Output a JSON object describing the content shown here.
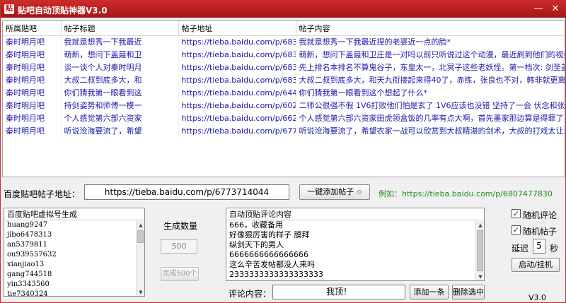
{
  "window": {
    "logo_glyph": "贴",
    "title": "贴吧自动顶贴神器V3.0",
    "minimize": "—",
    "close": "✕"
  },
  "table": {
    "columns": [
      "所属贴吧",
      "帖子标题",
      "帖子地址",
      "帖子内容"
    ],
    "rows": [
      [
        "秦时明月吧",
        "我就是想秀一下我最近",
        "https://tieba.baidu.com/p/683...",
        "我就是想秀一下我最近捏的老婆近一点的脸*"
      ],
      [
        "秦时明月吧",
        "萌新，想问下盖聂和卫",
        "https://tieba.baidu.com/p/683...",
        "萌新，想问下盖聂和卫庄是一对吗以前只听说过这个动漫，最近刷到他们的视频有..."
      ],
      [
        "秦时明月吧",
        "谈一谈个人对秦时明月",
        "https://tieba.baidu.com/p/683...",
        "先上排名本排名不算鬼谷子，东皇太一，北冥子这些老妖怪。第一档次: 剑圣盖聂..."
      ],
      [
        "秦时明月吧",
        "大叔二叔到底多大，和",
        "https://tieba.baidu.com/p/683...",
        "大叔二叔到底多大，和天九衔接起来得40了，赤练，张良也不对，韩非就更离谱，..."
      ],
      [
        "秦时明月吧",
        "你们猜我第一眼看到这",
        "https://tieba.baidu.com/p/644...",
        "你们猜我第一眼看到这个想起了什么*"
      ],
      [
        "秦时明月吧",
        "持剑姿势和师傅一模一",
        "https://tieba.baidu.com/p/602...",
        "二师公很强不假 1V6打败他们怕是玄了    1V6应该也没错 坚持了一会    伏念和张..."
      ],
      [
        "秦时明月吧",
        "个人感觉第六部六资家",
        "https://tieba.baidu.com/p/662...",
        "个人感觉第六部六资家田虎领盒饭的几率有点大啊，首先墨家那边算是得罪了，把..."
      ],
      [
        "秦时明月吧",
        "听说沧海要流了，希望",
        "https://tieba.baidu.com/p/677...",
        "听说沧海要流了，希望农家一战可以欣赏到大叔精湛的剑术，大叔的打戏太让人期..."
      ]
    ]
  },
  "address": {
    "label": "百度贴吧帖子地址：",
    "value": "https://tieba.baidu.com/p/6773714044",
    "add_button": "一键添加帖子",
    "example": "例如：https://tieba.baidu.com/p/6807477830"
  },
  "accounts": {
    "header": "百度贴吧虚拟号生成",
    "items": [
      "huang9247",
      "jibo6478313",
      "an5379811",
      "ou939557632",
      "xianjiao13",
      "gang744518",
      "yin3343560",
      "tie7340324"
    ]
  },
  "generate": {
    "label": "生成数量",
    "value": "500",
    "done_button": "完成500个"
  },
  "comments": {
    "header": "自动顶贴评论内容",
    "items": [
      "666，收藏备用",
      "好像狠厉害的样子  膜拜",
      "纵剑天下的男人",
      "6666666666666666",
      "这么辛苦发帖都没人来吗",
      "2333333333333333333"
    ],
    "input_label": "评论内容：",
    "input_value": "我顶！",
    "add_button": "添加一条",
    "delete_button": "删除选中"
  },
  "options": {
    "random_comment": {
      "label": "随机评论",
      "checked": true
    },
    "random_post": {
      "label": "随机帖子",
      "checked": true
    },
    "delay_label": "延迟",
    "delay_value": "5",
    "delay_unit": "秒",
    "start_button": "启动/挂机",
    "version": "V3.0"
  },
  "colors": {
    "titlebar": "#b81d1d",
    "link_text": "#1a1aa8",
    "example_text": "#1f8a1f"
  }
}
